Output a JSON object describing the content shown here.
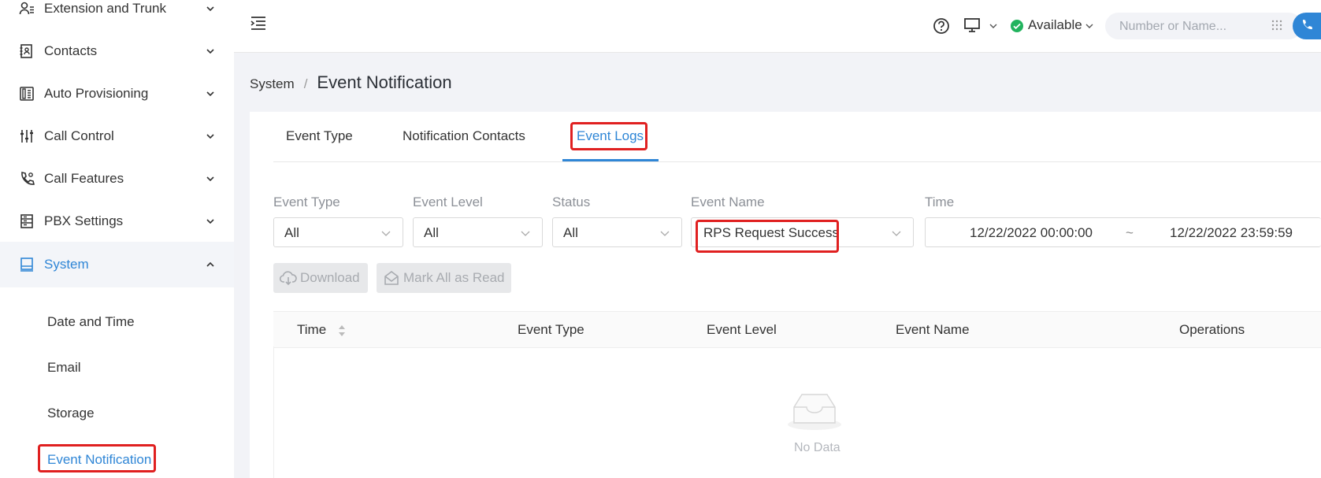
{
  "sidebar": {
    "items": [
      {
        "label": "Extension and Trunk",
        "icon": "user-list-icon"
      },
      {
        "label": "Contacts",
        "icon": "contacts-book-icon"
      },
      {
        "label": "Auto Provisioning",
        "icon": "phone-device-icon"
      },
      {
        "label": "Call Control",
        "icon": "sliders-icon"
      },
      {
        "label": "Call Features",
        "icon": "phone-settings-icon"
      },
      {
        "label": "PBX Settings",
        "icon": "server-icon"
      },
      {
        "label": "System",
        "icon": "monitor-icon",
        "active": true
      }
    ],
    "system_sub": [
      {
        "label": "Date and Time"
      },
      {
        "label": "Email"
      },
      {
        "label": "Storage"
      },
      {
        "label": "Event Notification",
        "active": true
      }
    ]
  },
  "topbar": {
    "status": "Available",
    "search_placeholder": "Number or Name...",
    "accent": "#2f86d6",
    "status_color": "#22b35e"
  },
  "breadcrumb": {
    "parent": "System",
    "separator": "/",
    "current": "Event Notification"
  },
  "tabs": [
    {
      "label": "Event Type"
    },
    {
      "label": "Notification Contacts"
    },
    {
      "label": "Event Logs",
      "active": true
    }
  ],
  "filters": {
    "event_type": {
      "label": "Event Type",
      "value": "All"
    },
    "event_level": {
      "label": "Event Level",
      "value": "All"
    },
    "status": {
      "label": "Status",
      "value": "All"
    },
    "event_name": {
      "label": "Event Name",
      "value": "RPS Request Success"
    },
    "time": {
      "label": "Time",
      "start": "12/22/2022 00:00:00",
      "separator": "~",
      "end": "12/22/2022 23:59:59"
    }
  },
  "actions": {
    "download": "Download",
    "mark_all_read": "Mark All as Read"
  },
  "table": {
    "columns": [
      "Time",
      "Event Type",
      "Event Level",
      "Event Name",
      "Operations"
    ],
    "empty_text": "No Data"
  }
}
